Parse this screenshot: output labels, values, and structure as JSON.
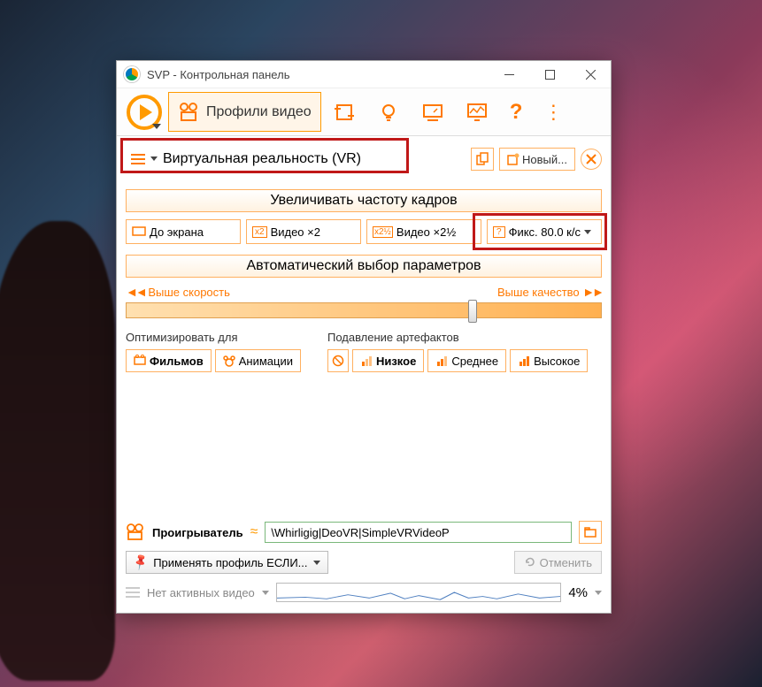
{
  "titlebar": {
    "title": "SVP - Контрольная панель"
  },
  "toolbar": {
    "profiles_label": "Профили видео"
  },
  "profile": {
    "name": "Виртуальная реальность (VR)",
    "new_label": "Новый..."
  },
  "fps": {
    "header": "Увеличивать частоту кадров",
    "btn1": "До экрана",
    "btn2": "Видео ×2",
    "btn3": "Видео ×2½",
    "btn4": "Фикс. 80.0 к/с"
  },
  "auto": {
    "header": "Автоматический выбор параметров",
    "left": "Выше скорость",
    "right": "Выше качество"
  },
  "optimize": {
    "label": "Оптимизировать для",
    "films": "Фильмов",
    "anim": "Анимации"
  },
  "artifacts": {
    "label": "Подавление артефактов",
    "low": "Низкое",
    "mid": "Среднее",
    "high": "Высокое"
  },
  "player": {
    "label": "Проигрыватель",
    "value": "\\Whirligig|DeoVR|SimpleVRVideoP"
  },
  "apply": {
    "label": "Применять профиль ЕСЛИ...",
    "cancel": "Отменить"
  },
  "status": {
    "text": "Нет активных видео",
    "pct": "4%"
  }
}
